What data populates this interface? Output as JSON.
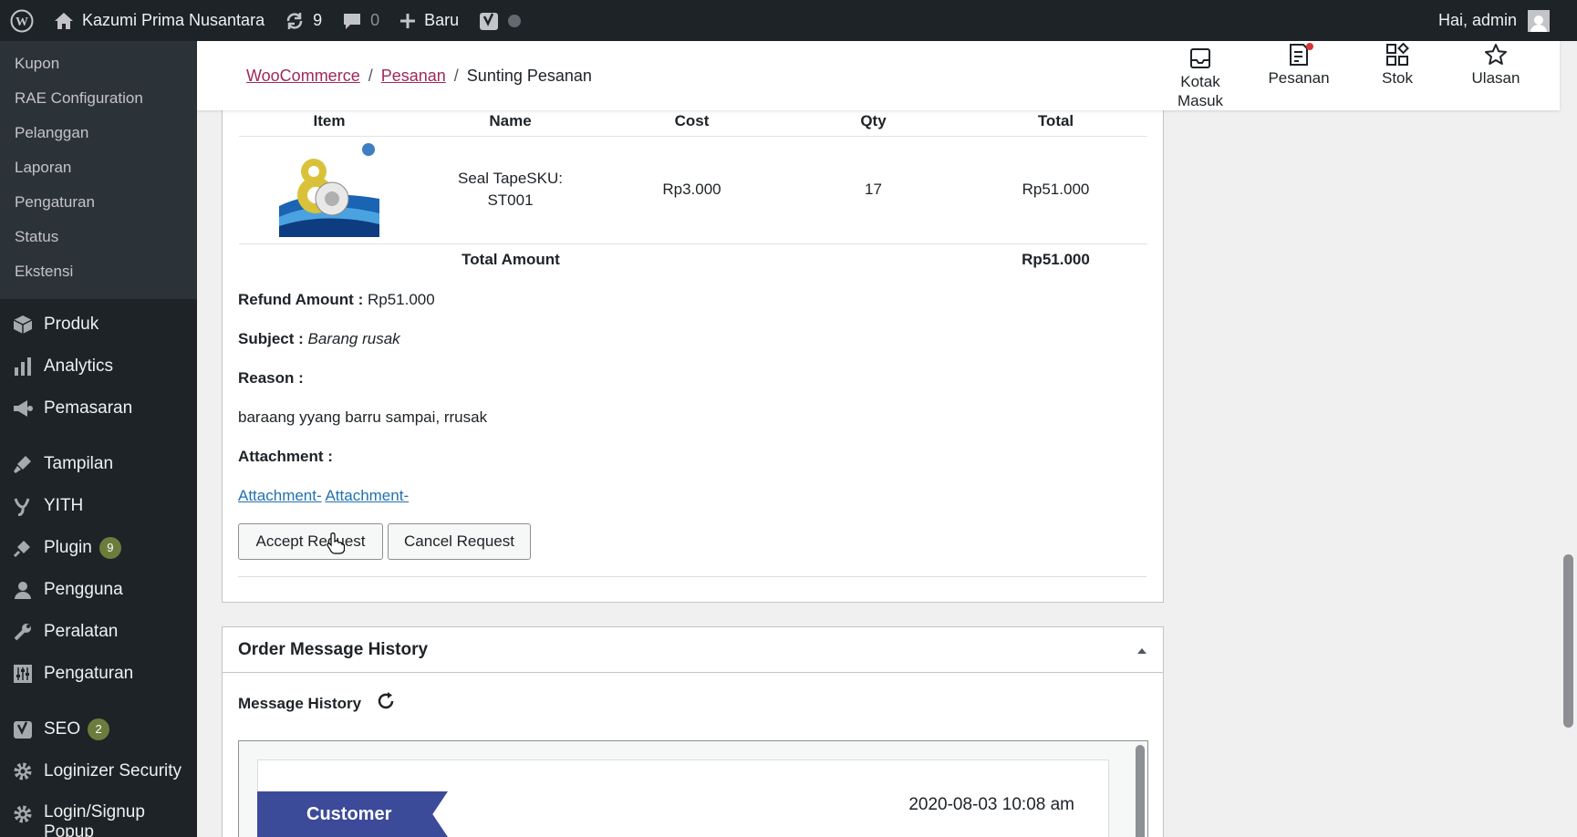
{
  "adminbar": {
    "site_name": "Kazumi Prima Nusantara",
    "updates_count": "9",
    "comments_count": "0",
    "new_label": "Baru",
    "greeting": "Hai, admin"
  },
  "sidebar": {
    "submenu": [
      "Kupon",
      "RAE Configuration",
      "Pelanggan",
      "Laporan",
      "Pengaturan",
      "Status",
      "Ekstensi"
    ],
    "menu": {
      "produk": "Produk",
      "analytics": "Analytics",
      "pemasaran": "Pemasaran",
      "tampilan": "Tampilan",
      "yith": "YITH",
      "plugin": "Plugin",
      "plugin_badge": "9",
      "pengguna": "Pengguna",
      "peralatan": "Peralatan",
      "pengaturan": "Pengaturan",
      "seo": "SEO",
      "seo_badge": "2",
      "loginizer": "Loginizer Security",
      "login_signup": "Login/Signup Popup"
    }
  },
  "header": {
    "breadcrumb": [
      "WooCommerce",
      "Pesanan",
      "Sunting Pesanan"
    ],
    "separator": "/",
    "actions": {
      "inbox": "Kotak Masuk",
      "orders": "Pesanan",
      "stock": "Stok",
      "reviews": "Ulasan"
    }
  },
  "refund": {
    "columns": [
      "Item",
      "Name",
      "Cost",
      "Qty",
      "Total"
    ],
    "rows": [
      {
        "name_line1": "Seal TapeSKU:",
        "name_line2": "ST001",
        "cost": "Rp3.000",
        "qty": "17",
        "total": "Rp51.000"
      }
    ],
    "total_label": "Total Amount",
    "total_value": "Rp51.000",
    "refund_amount_label": "Refund Amount :",
    "refund_amount_value": "Rp51.000",
    "subject_label": "Subject :",
    "subject_value": "Barang rusak",
    "reason_label": "Reason :",
    "reason_value": "baraang yyang barru sampai, rrusak",
    "attachment_label": "Attachment :",
    "attachments": [
      "Attachment-",
      "Attachment-"
    ],
    "accept_button": "Accept Request",
    "cancel_button": "Cancel Request"
  },
  "history": {
    "title": "Order Message History",
    "subtitle": "Message History",
    "message": {
      "sender": "Customer",
      "date": "2020-08-03 10:08 am"
    }
  },
  "colors": {
    "adminbar_bg": "#1d2327",
    "sidebar_bg": "#2c3338",
    "woo_link": "#a0285c",
    "link": "#2271b1",
    "ribbon": "#3c4a9a"
  }
}
